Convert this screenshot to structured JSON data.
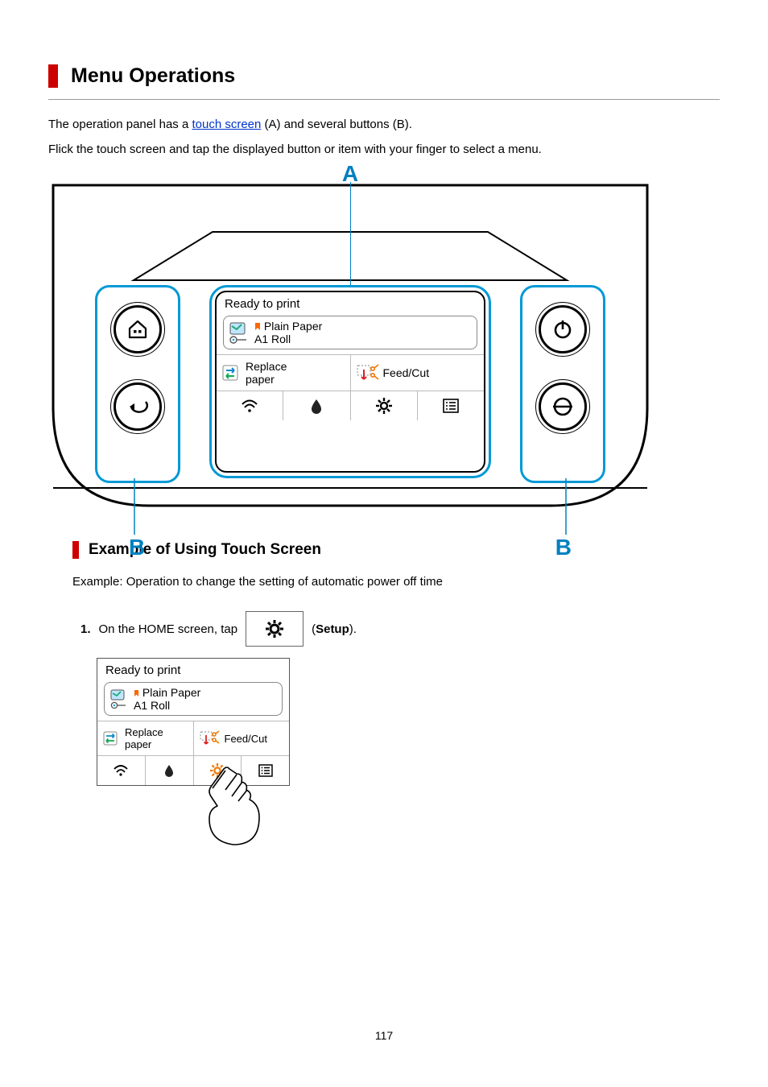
{
  "page_number": "117",
  "h1": "Menu Operations",
  "intro": {
    "pre_link": "The operation panel has a ",
    "link_text": "touch screen",
    "post_link": " (A) and several buttons (B).",
    "line2": "Flick the touch screen and tap the displayed button or item with your finger to select a menu."
  },
  "markers": {
    "a": "A",
    "b": "B"
  },
  "lcd": {
    "title": "Ready to print",
    "paper_type": "Plain Paper",
    "paper_size": "A1 Roll",
    "replace": "Replace\npaper",
    "feedcut": "Feed/Cut"
  },
  "h2": "Example of Using Touch Screen",
  "example_intro": "Example: Operation to change the setting of automatic power off time",
  "step1": {
    "num": "1.",
    "pre": "On the HOME screen, tap",
    "post_open": " (",
    "setup_bold": "Setup",
    "post_close": ")."
  }
}
